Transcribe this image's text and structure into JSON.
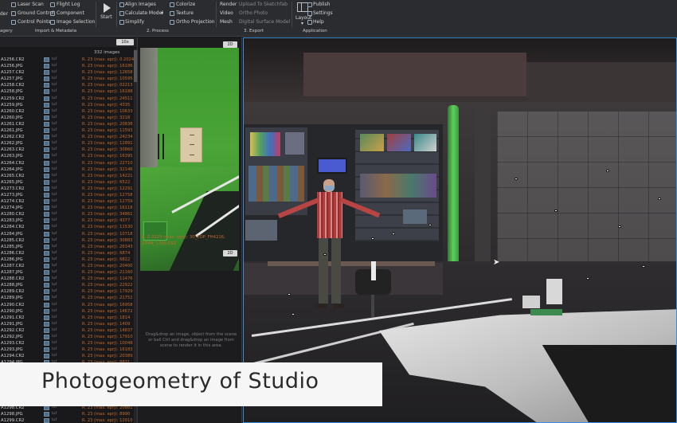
{
  "ribbon": {
    "col1": [
      "der"
    ],
    "col2": [
      "Laser Scan",
      "Ground Control",
      "Control Points"
    ],
    "col3": [
      "Flight Log",
      "Component",
      "Image Selection"
    ],
    "start_label": "Start",
    "col4": [
      "Align Images",
      "Calculate Model",
      "Simplify"
    ],
    "col5": [
      "Colorize",
      "Texture",
      "Ortho Projection"
    ],
    "col6": [
      "Render",
      "Video",
      "Mesh"
    ],
    "col7": [
      "Upload To Sketchfab",
      "Ortho Photo",
      "Digital Surface Model"
    ],
    "layout_label": "Layout",
    "col8": [
      "Publish",
      "Settings",
      "Help"
    ],
    "sections": [
      "agery",
      "Import & Metadata",
      "2. Process",
      "3. Export",
      "Application"
    ]
  },
  "image_list": {
    "count_badge": "10x",
    "count_label": "332 images",
    "rows": [
      {
        "file": "A1256.CR2",
        "ext": "tuf",
        "err": "R. 23 (max. eprj): 0.2024"
      },
      {
        "file": "A1256.JPG",
        "ext": "tuf",
        "err": "R. 23 (max. eprj): 16186"
      },
      {
        "file": "A1257.CR2",
        "ext": "tuf",
        "err": "R. 23 (max. eprj): 12658"
      },
      {
        "file": "A1257.JPG",
        "ext": "tuf",
        "err": "R. 23 (max. eprj): 10595"
      },
      {
        "file": "A1258.CR2",
        "ext": "tuf",
        "err": "R. 23 (max. eprj): 02213"
      },
      {
        "file": "A1258.JPG",
        "ext": "tuf",
        "err": "R. 23 (max. eprj): 16188"
      },
      {
        "file": "A1259.CR2",
        "ext": "tuf",
        "err": "R. 23 (max. eprj): 24511"
      },
      {
        "file": "A1259.JPG",
        "ext": "tuf",
        "err": "R. 23 (max. eprj): 4335"
      },
      {
        "file": "A1260.CR2",
        "ext": "tuf",
        "err": "R. 23 (max. eprj): 10633"
      },
      {
        "file": "A1260.JPG",
        "ext": "tuf",
        "err": "R. 23 (max. eprj): 3218"
      },
      {
        "file": "A1261.CR2",
        "ext": "tuf",
        "err": "R. 23 (max. eprj): 20838"
      },
      {
        "file": "A1261.JPG",
        "ext": "tuf",
        "err": "R. 23 (max. eprj): 11593"
      },
      {
        "file": "A1262.CR2",
        "ext": "tuf",
        "err": "R. 23 (max. eprj): 24234"
      },
      {
        "file": "A1262.JPG",
        "ext": "tuf",
        "err": "R. 23 (max. eprj): 12891"
      },
      {
        "file": "A1263.CR2",
        "ext": "tuf",
        "err": "R. 23 (max. eprj): 30860"
      },
      {
        "file": "A1263.JPG",
        "ext": "tuf",
        "err": "R. 23 (max. eprj): 16395"
      },
      {
        "file": "A1264.CR2",
        "ext": "tuf",
        "err": "R. 23 (max. eprj): 22710"
      },
      {
        "file": "A1264.JPG",
        "ext": "tuf",
        "err": "R. 23 (max. eprj): 32146"
      },
      {
        "file": "A1265.CR2",
        "ext": "tuf",
        "err": "R. 23 (max. eprj): 14221"
      },
      {
        "file": "A1265.JPG",
        "ext": "tuf",
        "err": "R. 23 (max. eprj): 6522"
      },
      {
        "file": "A1273.CR2",
        "ext": "tuf",
        "err": "R. 23 (max. eprj): 12291"
      },
      {
        "file": "A1273.JPG",
        "ext": "tuf",
        "err": "R. 23 (max. eprj): 12758"
      },
      {
        "file": "A1274.CR2",
        "ext": "tuf",
        "err": "R. 23 (max. eprj): 12759"
      },
      {
        "file": "A1274.JPG",
        "ext": "tuf",
        "err": "R. 23 (max. eprj): 16118"
      },
      {
        "file": "A1280.CR2",
        "ext": "tuf",
        "err": "R. 23 (max. eprj): 34861"
      },
      {
        "file": "A1283.JPG",
        "ext": "tuf",
        "err": "R. 23 (max. eprj): 4377"
      },
      {
        "file": "A1284.CR2",
        "ext": "tuf",
        "err": "R. 23 (max. eprj): 11530"
      },
      {
        "file": "A1284.JPG",
        "ext": "tuf",
        "err": "R. 23 (max. eprj): 10718"
      },
      {
        "file": "A1285.CR2",
        "ext": "tuf",
        "err": "R. 23 (max. eprj): 30883"
      },
      {
        "file": "A1285.JPG",
        "ext": "tuf",
        "err": "R. 23 (max. eprj): 26343"
      },
      {
        "file": "A1286.CR2",
        "ext": "tuf",
        "err": "R. 23 (max. eprj): 6874"
      },
      {
        "file": "A1286.JPG",
        "ext": "tuf",
        "err": "R. 23 (max. eprj): 6822"
      },
      {
        "file": "A1287.CR2",
        "ext": "tuf",
        "err": "R. 23 (max. eprj): 20400"
      },
      {
        "file": "A1287.JPG",
        "ext": "tuf",
        "err": "R. 23 (max. eprj): 21160"
      },
      {
        "file": "A1288.CR2",
        "ext": "tuf",
        "err": "R. 23 (max. eprj): 11476"
      },
      {
        "file": "A1288.JPG",
        "ext": "tuf",
        "err": "R. 23 (max. eprj): 22922"
      },
      {
        "file": "A1289.CR2",
        "ext": "tuf",
        "err": "R. 23 (max. eprj): 17929"
      },
      {
        "file": "A1289.JPG",
        "ext": "tuf",
        "err": "R. 23 (max. eprj): 21752"
      },
      {
        "file": "A1290.CR2",
        "ext": "tuf",
        "err": "R. 23 (max. eprj): 16958"
      },
      {
        "file": "A1290.JPG",
        "ext": "tuf",
        "err": "R. 23 (max. eprj): 14672"
      },
      {
        "file": "A1291.CR2",
        "ext": "tuf",
        "err": "R. 23 (max. eprj): 1814"
      },
      {
        "file": "A1291.JPG",
        "ext": "tuf",
        "err": "R. 23 (max. eprj): 1409"
      },
      {
        "file": "A1292.CR2",
        "ext": "tuf",
        "err": "R. 23 (max. eprj): 14837"
      },
      {
        "file": "A1292.JPG",
        "ext": "tuf",
        "err": "R. 23 (max. eprj): 17910"
      },
      {
        "file": "A1293.CR2",
        "ext": "tuf",
        "err": "R. 23 (max. eprj): 10048"
      },
      {
        "file": "A1293.JPG",
        "ext": "tuf",
        "err": "R. 23 (max. eprj): 16183"
      },
      {
        "file": "A1294.CR2",
        "ext": "tuf",
        "err": "R. 23 (max. eprj): 20389"
      },
      {
        "file": "A1294.JPG",
        "ext": "tuf",
        "err": "R. 23 (max. eprj): 8831"
      },
      {
        "file": "A1295.CR2",
        "ext": "tuf",
        "err": "R. 23 (max. eprj): 11287"
      },
      {
        "file": "A1295.JPG",
        "ext": "tuf",
        "err": "R. 23 (max. eprj): 12411"
      },
      {
        "file": "A1296.CR2",
        "ext": "tuf",
        "err": "R. 23 (max. eprj): 20882"
      },
      {
        "file": "A1296.JPG",
        "ext": "tuf",
        "err": "R. 23 (max. eprj): 20881"
      },
      {
        "file": "A1297.CR2",
        "ext": "tuf",
        "err": "R. 23 (max. eprj): 17530"
      },
      {
        "file": "A1297.JPG",
        "ext": "tuf",
        "err": "R. 23 (max. eprj): 15440"
      },
      {
        "file": "A1298.CR2",
        "ext": "tuf",
        "err": "R. 23 (max. eprj): 20881"
      },
      {
        "file": "A1298.JPG",
        "ext": "tuf",
        "err": "R. 23 (max. eprj): 8990"
      },
      {
        "file": "A1299.CR2",
        "ext": "tuf",
        "err": "R. 23 (max. eprj): 12010"
      },
      {
        "file": "A1299.JPG",
        "ext": "tuf",
        "err": "R. 23 (max. eprj): 4488"
      }
    ]
  },
  "photo_panel": {
    "badge_top": "2D",
    "caption": "R. 0.0229 (max. eprj): 30_EOP_FH4216, 27M4_1256.CR2",
    "badge_bottom": "2D",
    "drop_hint": "Drag&drop an image, object from the scene or ball Ctrl and drag&drop an image from scene to render it in this area."
  },
  "overlay": {
    "caption": "Photogeometry of Studio"
  },
  "colors": {
    "accent": "#3f8fd8",
    "error_text": "#c06a2c",
    "green_screen": "#4aa437"
  }
}
